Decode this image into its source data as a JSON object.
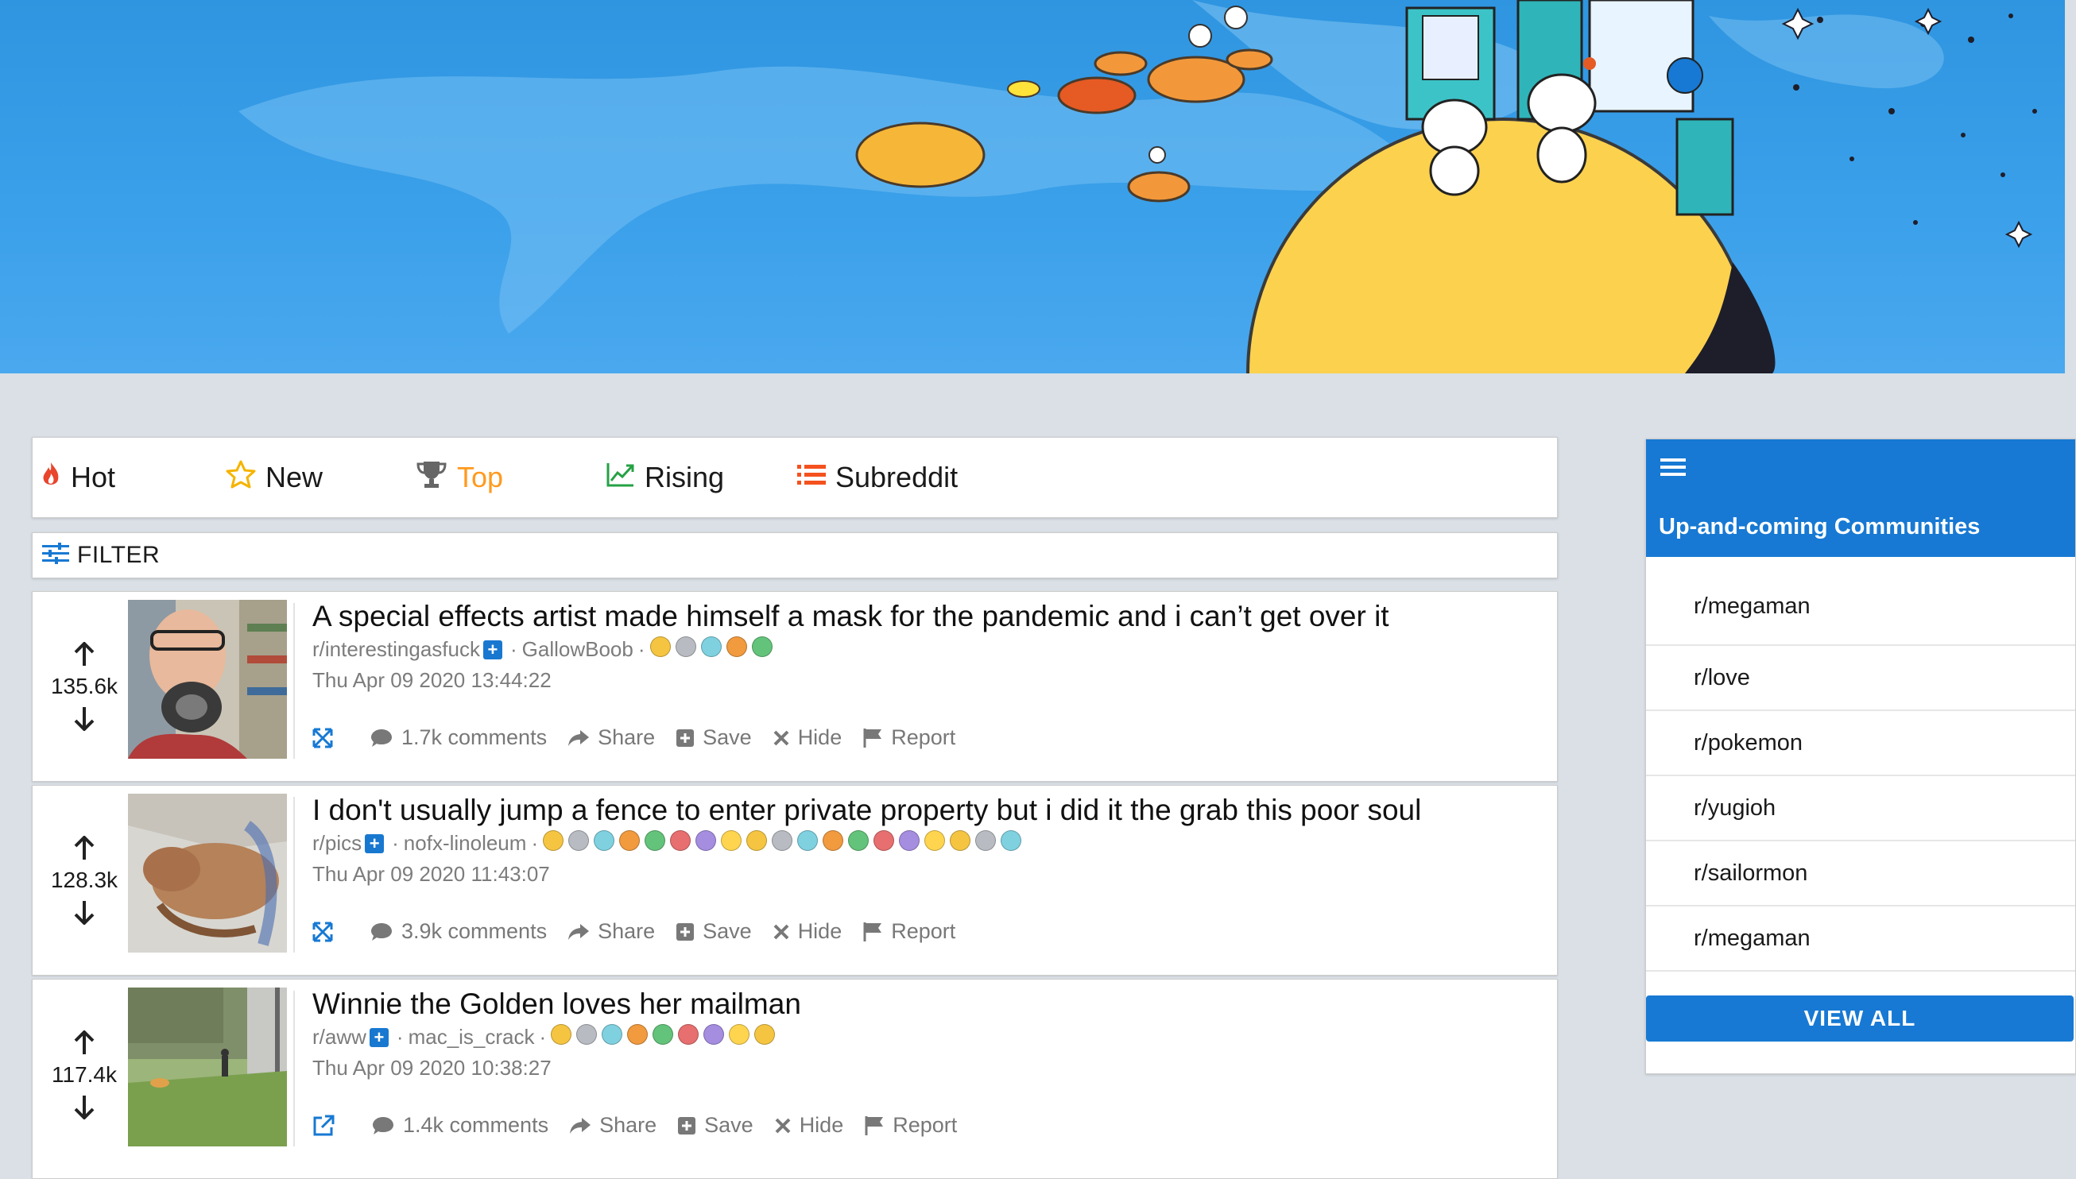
{
  "colors": {
    "accent": "#1779d3",
    "active_sort": "#ff9a1f",
    "hot_icon": "#e8452c",
    "new_icon": "#f5b400",
    "rising_icon": "#25a244",
    "subreddit_icon": "#f4511e",
    "background": "#dae0e6"
  },
  "sortbar": {
    "tabs": [
      {
        "label": "Hot",
        "icon": "flame-icon",
        "active": false
      },
      {
        "label": "New",
        "icon": "star-icon",
        "active": false
      },
      {
        "label": "Top",
        "icon": "trophy-icon",
        "active": true
      },
      {
        "label": "Rising",
        "icon": "trend-up-icon",
        "active": false
      },
      {
        "label": "Subreddit",
        "icon": "list-icon",
        "active": false
      }
    ]
  },
  "filter": {
    "label": "FILTER",
    "icon": "sliders-icon"
  },
  "posts": [
    {
      "score": "135.6k",
      "title": "A special effects artist made himself a mask for the pandemic and i can’t get over it",
      "subreddit": "r/interestingasfuck",
      "author": "GallowBoob",
      "date": "Thu Apr 09 2020 13:44:22",
      "comments": "1.7k comments",
      "expand_icon": "expand-icon",
      "awards": 5
    },
    {
      "score": "128.3k",
      "title": "I don't usually jump a fence to enter private property but i did it the grab this poor soul",
      "subreddit": "r/pics",
      "author": "nofx-linoleum",
      "date": "Thu Apr 09 2020 11:43:07",
      "comments": "3.9k comments",
      "expand_icon": "expand-icon",
      "awards": 19
    },
    {
      "score": "117.4k",
      "title": "Winnie the Golden loves her mailman",
      "subreddit": "r/aww",
      "author": "mac_is_crack",
      "date": "Thu Apr 09 2020 10:38:27",
      "comments": "1.4k comments",
      "expand_icon": "external-link-icon",
      "awards": 9
    }
  ],
  "actions": {
    "share": "Share",
    "save": "Save",
    "hide": "Hide",
    "report": "Report"
  },
  "meta_separator": "·",
  "sidebar": {
    "title": "Up-and-coming Communities",
    "menu_icon": "hamburger-icon",
    "communities": [
      "r/megaman",
      "r/love",
      "r/pokemon",
      "r/yugioh",
      "r/sailormon",
      "r/megaman"
    ],
    "view_all": "VIEW ALL"
  }
}
